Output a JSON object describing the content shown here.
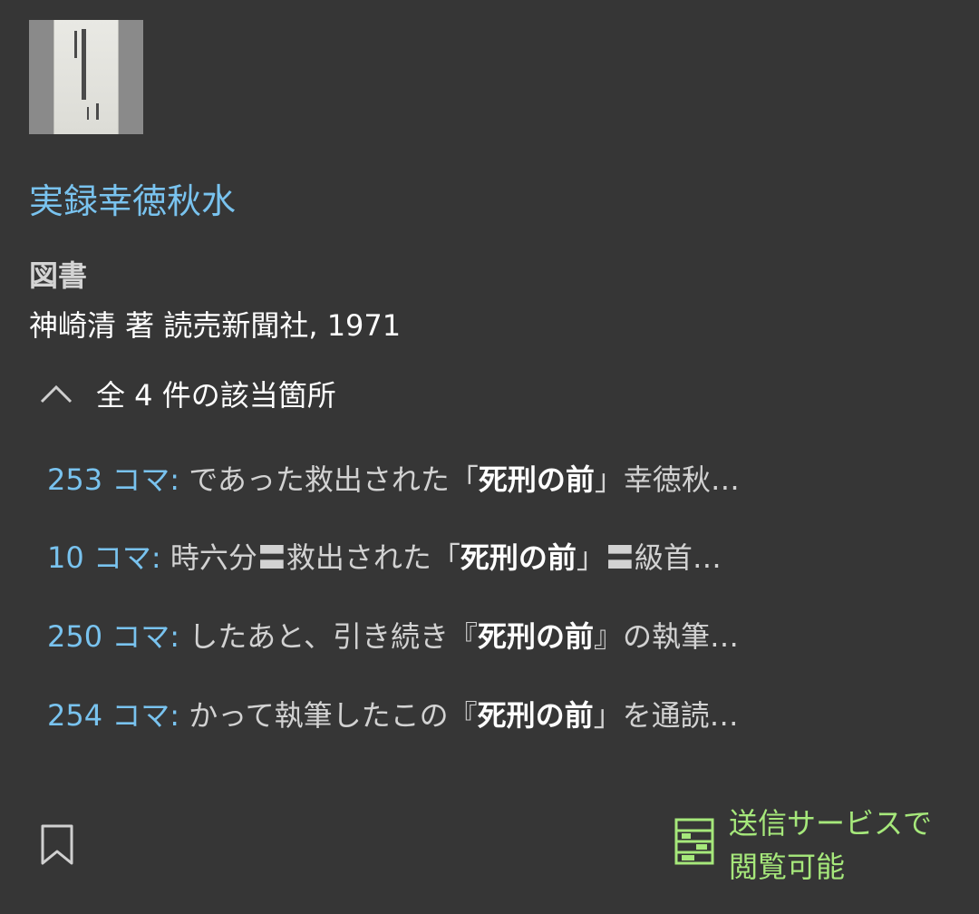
{
  "item": {
    "title": "実録幸徳秋水",
    "type": "図書",
    "meta": "神崎清 著 読売新聞社, 1971"
  },
  "hits": {
    "toggle_label": "全 4 件の該当箇所",
    "items": [
      {
        "frame": "253 コマ:",
        "before": " であった救出された「",
        "term": "死刑の前",
        "after": "」幸徳秋…"
      },
      {
        "frame": "10 コマ:",
        "before": " 時六分〓救出された「",
        "term": "死刑の前",
        "after": "」〓級首…"
      },
      {
        "frame": "250 コマ:",
        "before": " したあと、引き続き『",
        "term": "死刑の前",
        "after": "』の執筆…"
      },
      {
        "frame": "254 コマ:",
        "before": " かって執筆したこの『",
        "term": "死刑の前",
        "after": "」を通読…"
      }
    ]
  },
  "footer": {
    "delivery_line1": "送信サービスで",
    "delivery_line2": "閲覧可能"
  },
  "icons": {
    "toggle": "chevron-up-icon",
    "bookmark": "bookmark-icon",
    "delivery": "delivery-service-icon"
  },
  "colors": {
    "background": "#363636",
    "link": "#79c3ef",
    "available": "#a6e87b"
  }
}
